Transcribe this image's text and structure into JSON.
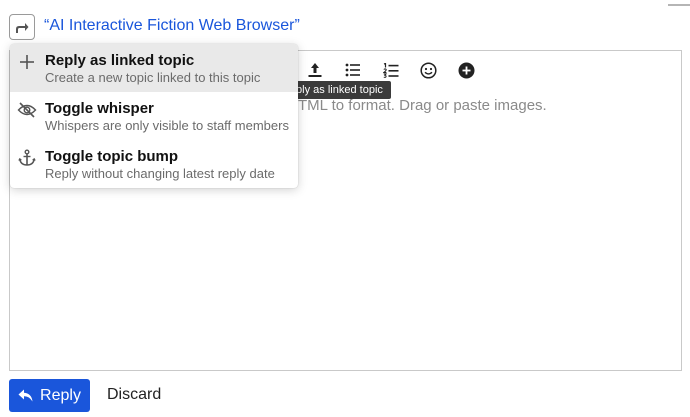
{
  "composer": {
    "topic_title": "“AI Interactive Fiction Web Browser”",
    "placeholder": "TML to format. Drag or paste images."
  },
  "toolbar": {
    "buttons": [
      {
        "icon": "upload-icon"
      },
      {
        "icon": "bullet-list-icon"
      },
      {
        "icon": "numbered-list-icon"
      },
      {
        "icon": "emoji-icon"
      },
      {
        "icon": "plus-circle-icon"
      }
    ],
    "tooltip": "Reply as linked topic"
  },
  "menu": {
    "items": [
      {
        "icon": "plus-icon",
        "title": "Reply as linked topic",
        "description": "Create a new topic linked to this topic"
      },
      {
        "icon": "eye-slash-icon",
        "title": "Toggle whisper",
        "description": "Whispers are only visible to staff members"
      },
      {
        "icon": "anchor-icon",
        "title": "Toggle topic bump",
        "description": "Reply without changing latest reply date"
      }
    ]
  },
  "footer": {
    "reply_label": "Reply",
    "discard_label": "Discard"
  },
  "colors": {
    "accent": "#1a56db",
    "tooltip_bg": "#3b3b3b",
    "menu_highlight": "#e9e9e9"
  }
}
